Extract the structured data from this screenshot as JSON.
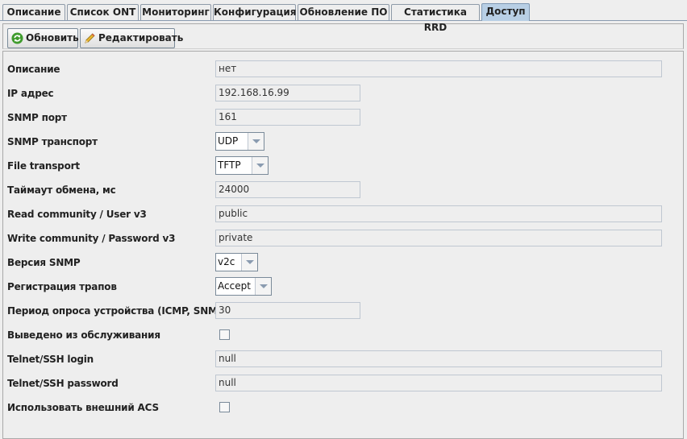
{
  "tabs": [
    {
      "label": "Описание",
      "active": false
    },
    {
      "label": "Список ONT",
      "active": false
    },
    {
      "label": "Мониторинг",
      "active": false
    },
    {
      "label": "Конфигурация",
      "active": false
    },
    {
      "label": "Обновление ПО",
      "active": false
    },
    {
      "label": "Статистика RRD",
      "active": false
    },
    {
      "label": "Доступ",
      "active": true
    }
  ],
  "toolbar": {
    "refresh_label": "Обновить",
    "refresh_icon": "refresh-icon",
    "edit_label": "Редактировать",
    "edit_icon": "pencil-icon"
  },
  "form": {
    "description": {
      "label": "Описание",
      "value": "нет"
    },
    "ip": {
      "label": "IP адрес",
      "value": "192.168.16.99"
    },
    "snmp_port": {
      "label": "SNMP порт",
      "value": "161"
    },
    "snmp_transport": {
      "label": "SNMP транспорт",
      "value": "UDP"
    },
    "file_transport": {
      "label": "File transport",
      "value": "TFTP"
    },
    "timeout": {
      "label": "Таймаут обмена, мс",
      "value": "24000"
    },
    "read_community": {
      "label": "Read community / User v3",
      "value": "public"
    },
    "write_community": {
      "label": "Write community / Password v3",
      "value": "private"
    },
    "snmp_version": {
      "label": "Версия SNMP",
      "value": "v2c"
    },
    "trap_registration": {
      "label": "Регистрация трапов",
      "value": "Accept"
    },
    "poll_period": {
      "label": "Период опроса устройства (ICMP, SNMP), с",
      "value": "30"
    },
    "out_of_service": {
      "label": "Выведено из обслуживания",
      "checked": false
    },
    "telnet_login": {
      "label": "Telnet/SSH login",
      "value": "null"
    },
    "telnet_password": {
      "label": "Telnet/SSH password",
      "value": "null"
    },
    "external_acs": {
      "label": "Использовать внешний ACS",
      "checked": false
    }
  },
  "colors": {
    "active_tab": "#b8cfe5",
    "background": "#eeeeee",
    "border": "#7a8a99"
  }
}
